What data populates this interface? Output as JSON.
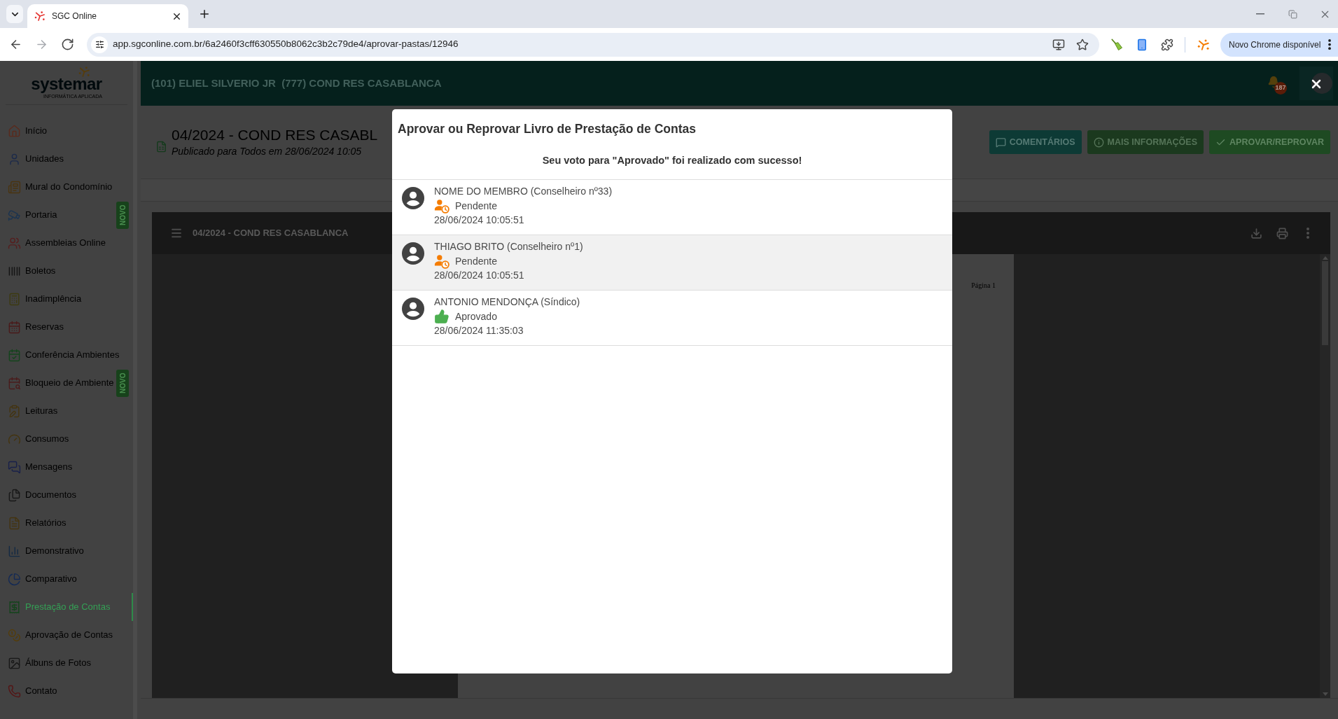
{
  "browser": {
    "tabs": [
      {
        "title": "SGC Online",
        "selected": true
      }
    ],
    "nav_buttons": [
      {
        "kind": "back",
        "disabled": false
      },
      {
        "kind": "forward",
        "disabled": true
      },
      {
        "kind": "reload",
        "disabled": false
      }
    ],
    "url": "app.sgconline.com.br/6a2460f3cff630550b8062c3b2c79de4/aprovar-pastas/12946",
    "update_button": "Novo Chrome disponível"
  },
  "sidebar": {
    "logo": {
      "name": "systemar",
      "tagline": "INFORMÁTICA APLICADA"
    },
    "items": [
      {
        "label": "Início",
        "selected": false
      },
      {
        "label": "Unidades",
        "selected": false
      },
      {
        "label": "Mural do Condomínio",
        "selected": false
      },
      {
        "label": "Portaria",
        "selected": false,
        "badge": "NOVO"
      },
      {
        "label": "Assembleias Online",
        "selected": false
      },
      {
        "label": "Boletos",
        "selected": false
      },
      {
        "label": "Inadimplência",
        "selected": false
      },
      {
        "label": "Reservas",
        "selected": false
      },
      {
        "label": "Conferência Ambientes",
        "selected": false
      },
      {
        "label": "Bloqueio de Ambiente",
        "selected": false,
        "badge": "NOVO"
      },
      {
        "label": "Leituras",
        "selected": false
      },
      {
        "label": "Consumos",
        "selected": false
      },
      {
        "label": "Mensagens",
        "selected": false
      },
      {
        "label": "Documentos",
        "selected": false
      },
      {
        "label": "Relatórios",
        "selected": false
      },
      {
        "label": "Demonstrativo",
        "selected": false
      },
      {
        "label": "Comparativo",
        "selected": false
      },
      {
        "label": "Prestação de Contas",
        "selected": true
      },
      {
        "label": "Aprovação de Contas",
        "selected": false
      },
      {
        "label": "Álbuns de Fotos",
        "selected": false
      },
      {
        "label": "Contato",
        "selected": false
      }
    ]
  },
  "header": {
    "user": "(101) ELIEL SILVERIO JR  (777) COND RES CASABLANCA",
    "notification_count": "187"
  },
  "document": {
    "title": "04/2024 - COND RES CASABL",
    "published": "Publicado para Todos em 28/06/2024 10:05",
    "actions": [
      {
        "kind": "comments",
        "label": "COMENTÁRIOS"
      },
      {
        "kind": "info",
        "label": "MAIS INFORMAÇÕES"
      },
      {
        "kind": "approve",
        "label": "APROVAR/REPROVAR"
      }
    ]
  },
  "viewer": {
    "title": "04/2024 - COND RES CASABLANCA",
    "page_label": "Página 1"
  },
  "modal": {
    "title": "Aprovar ou Reprovar Livro de Prestação de Contas",
    "message": "Seu voto para \"Aprovado\" foi realizado com sucesso!",
    "votes": [
      {
        "member": "NOME DO MEMBRO (Conselheiro nº33)",
        "status": {
          "kind": "pending",
          "label": "Pendente"
        },
        "date": "28/06/2024 10:05:51",
        "hovered": false
      },
      {
        "member": "THIAGO BRITO (Conselheiro nº1)",
        "status": {
          "kind": "pending",
          "label": "Pendente"
        },
        "date": "28/06/2024 10:05:51",
        "hovered": true
      },
      {
        "member": "ANTONIO MENDONÇA (Síndico)",
        "status": {
          "kind": "approved",
          "label": "Aprovado"
        },
        "date": "28/06/2024 11:35:03",
        "hovered": false
      }
    ]
  }
}
